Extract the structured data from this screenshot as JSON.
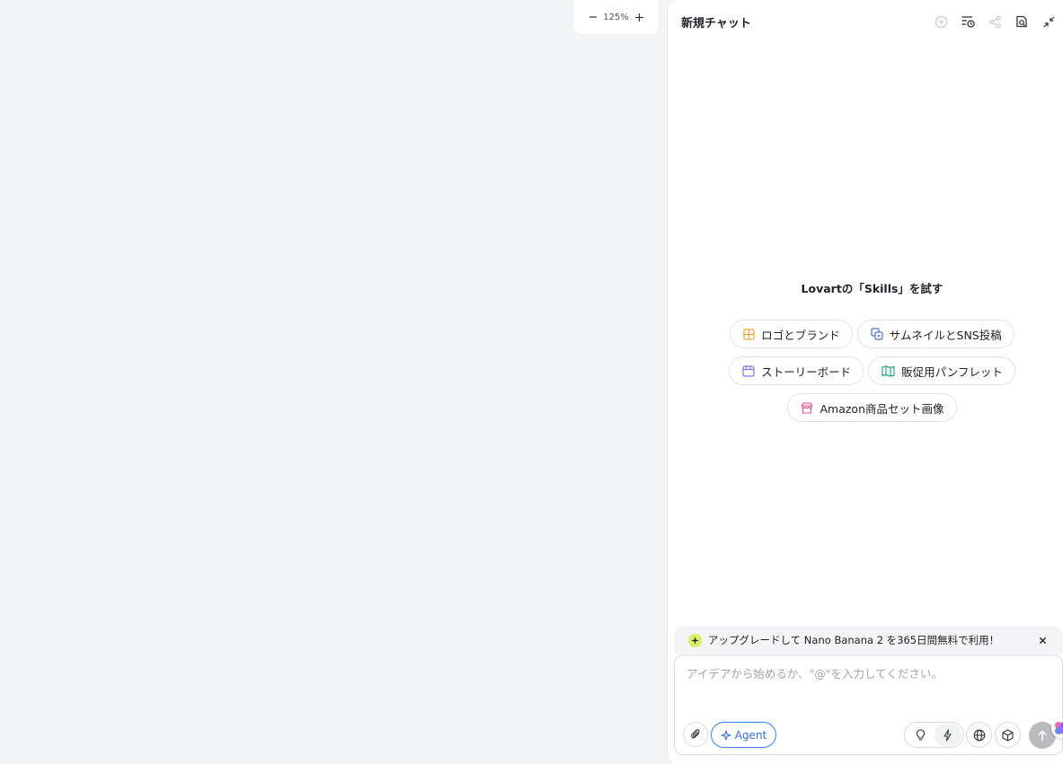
{
  "canvas": {
    "zoom_level": "125%"
  },
  "chat": {
    "title": "新規チャット",
    "skills_heading": "Lovartの「Skills」を試す",
    "skills": [
      {
        "label": "ロゴとブランド",
        "icon": "grid-icon",
        "color": "#f0a020"
      },
      {
        "label": "サムネイルとSNS投稿",
        "icon": "images-icon",
        "color": "#4a6bf0"
      },
      {
        "label": "ストーリーボード",
        "icon": "storyboard-icon",
        "color": "#8a6cf0"
      },
      {
        "label": "販促用パンフレット",
        "icon": "map-icon",
        "color": "#22a889"
      },
      {
        "label": "Amazon商品セット画像",
        "icon": "store-icon",
        "color": "#e04a8a"
      }
    ]
  },
  "banner": {
    "text": "アップグレードして Nano Banana 2 を365日間無料で利用！"
  },
  "composer": {
    "placeholder": "アイデアから始めるか、\"@\"を入力してください。",
    "agent_label": "Agent"
  }
}
